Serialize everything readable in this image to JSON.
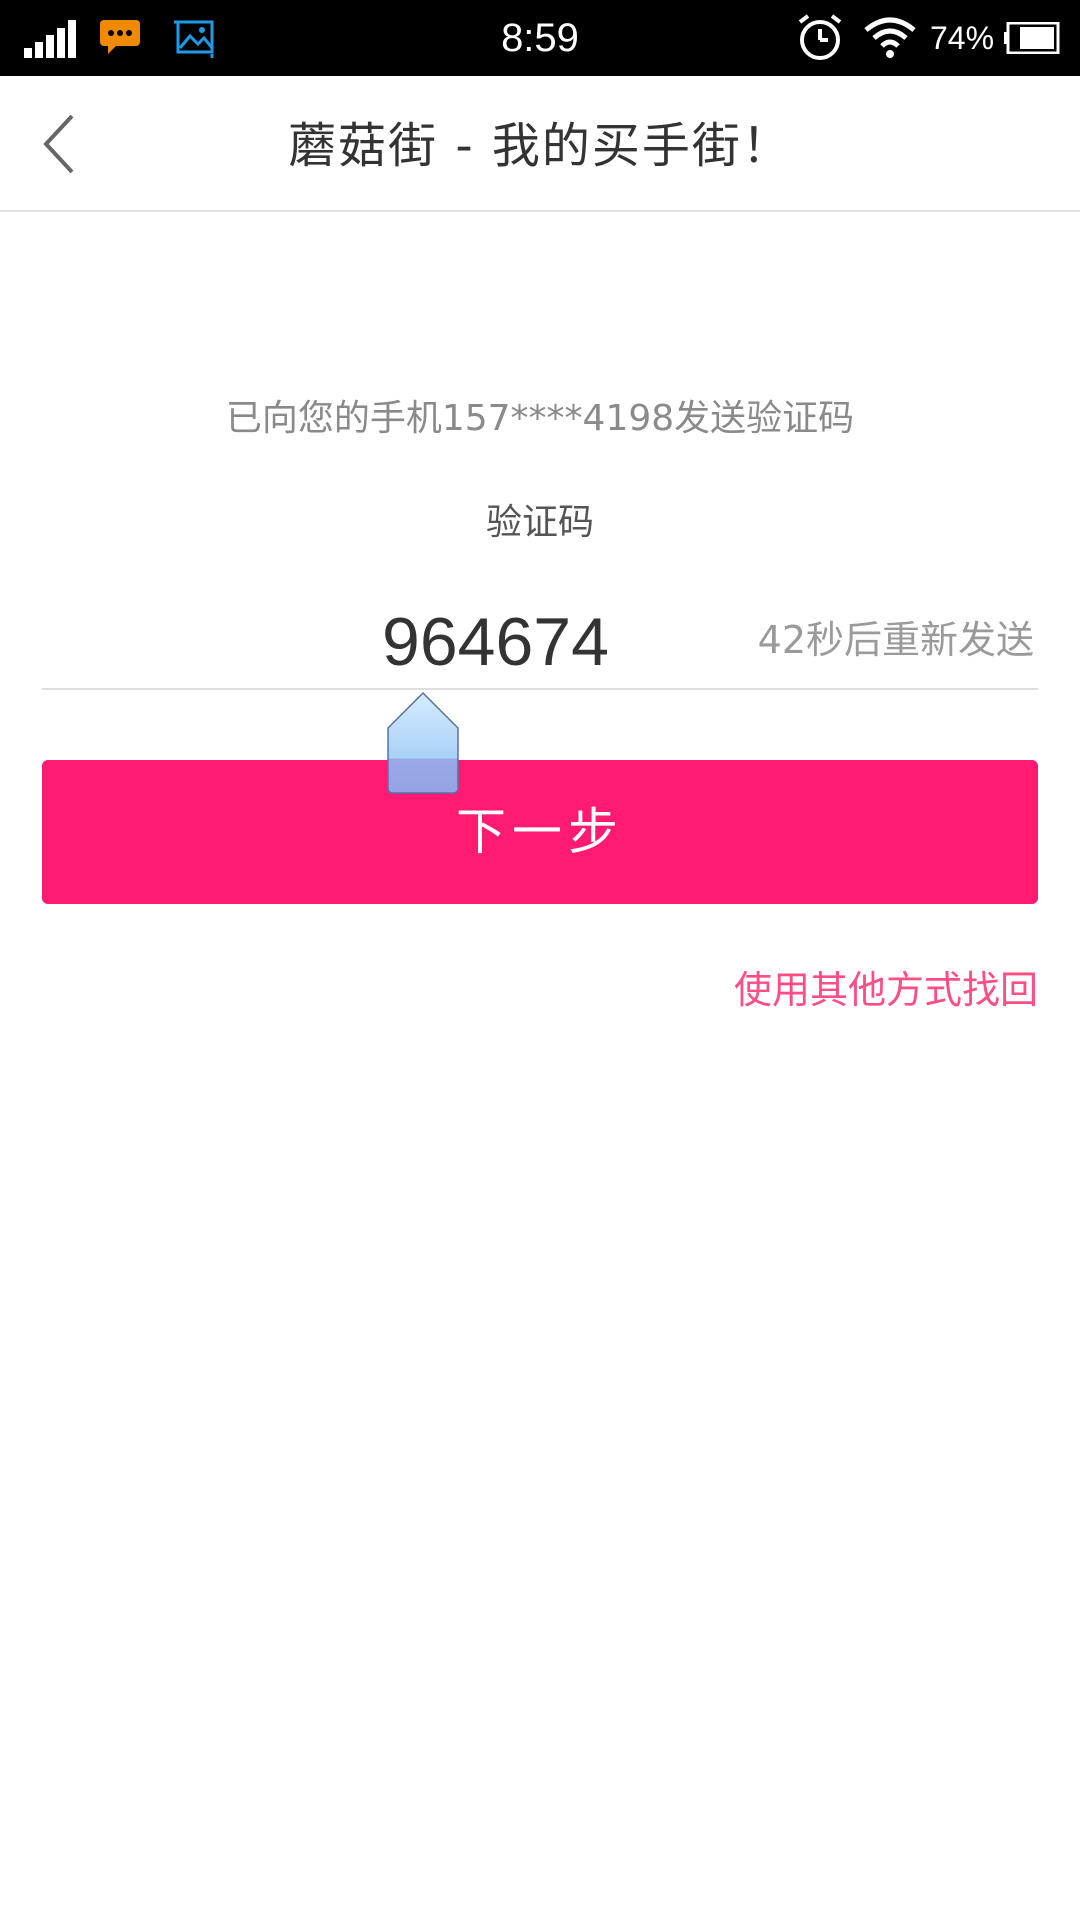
{
  "status_bar": {
    "time": "8:59",
    "battery": "74%",
    "icons": [
      "signal-icon",
      "message-icon",
      "image-icon",
      "alarm-icon",
      "wifi-icon",
      "battery-icon"
    ]
  },
  "nav": {
    "title": "蘑菇街 - 我的买手街！",
    "back_icon": "chevron-left-icon"
  },
  "form": {
    "hint": "已向您的手机157****4198发送验证码",
    "code_label": "验证码",
    "code_value": "964674",
    "resend_label": "42秒后重新发送",
    "next_label": "下一步",
    "alt_link": "使用其他方式找回"
  },
  "colors": {
    "accent": "#ff1a72",
    "link": "#ff4d86"
  }
}
